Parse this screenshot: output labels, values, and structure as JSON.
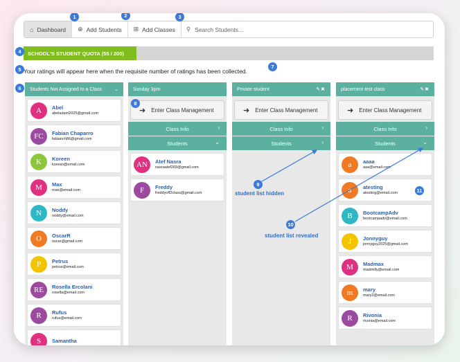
{
  "nav": {
    "dashboard": "Dashboard",
    "add_students": "Add Students",
    "add_classes": "Add Classes",
    "search_placeholder": "Search Students..."
  },
  "quota": {
    "label": "SCHOOL'S STUDENT QUOTA (55 / 200)",
    "used": 55,
    "total": 200
  },
  "ratings_message": "Your ratings will appear here when the requisite number of ratings has been collected.",
  "unassigned": {
    "title": "Students Not Assigned to a Class",
    "students": [
      {
        "initials": "A",
        "name": "Abel",
        "email": "abeladam2025@gmail.com",
        "color": "#e0307f"
      },
      {
        "initials": "FC",
        "name": "Fabian Chaparro",
        "email": "fabianch86@gmail.com",
        "color": "#9b4aa0"
      },
      {
        "initials": "K",
        "name": "Koreen",
        "email": "korean@email.com",
        "color": "#8cc63f"
      },
      {
        "initials": "M",
        "name": "Max",
        "email": "max@email.com",
        "color": "#e0307f"
      },
      {
        "initials": "N",
        "name": "Noddy",
        "email": "noddy@email.com",
        "color": "#2cb8c4"
      },
      {
        "initials": "O",
        "name": "OscarR",
        "email": "oscar@gmail.com",
        "color": "#f07a23"
      },
      {
        "initials": "P",
        "name": "Petrus",
        "email": "petrus@email.com",
        "color": "#f5c400"
      },
      {
        "initials": "RE",
        "name": "Rosella Ercolani",
        "email": "rosella@email.com",
        "color": "#9b4aa0"
      },
      {
        "initials": "R",
        "name": "Rufus",
        "email": "rufus@email.com",
        "color": "#9b4aa0"
      },
      {
        "initials": "S",
        "name": "Samantha",
        "email": "",
        "color": "#e0307f"
      }
    ]
  },
  "classes": [
    {
      "title": "Sunday 3pm",
      "enter_label": "Enter Class Management",
      "info_label": "Class Info",
      "students_label": "Students",
      "students": [
        {
          "initials": "AN",
          "name": "Atef Nasra",
          "email": "nasraatef269@gmail.com",
          "color": "#e0307f"
        },
        {
          "initials": "F",
          "name": "Freddy",
          "email": "freddyoff2class@gmail.com",
          "color": "#9b4aa0"
        }
      ]
    },
    {
      "title": "Private student",
      "enter_label": "Enter Class Management",
      "info_label": "Class Info",
      "students_label": "Students",
      "students": []
    },
    {
      "title": "placement test class",
      "enter_label": "Enter Class Management",
      "info_label": "Class Info",
      "students_label": "Students",
      "students": [
        {
          "initials": "a",
          "name": "aaaa",
          "email": "aaa@email.com",
          "color": "#f07a23"
        },
        {
          "initials": "a",
          "name": "atesting",
          "email": "atesting@email.com",
          "color": "#f07a23"
        },
        {
          "initials": "B",
          "name": "BootcampAdv",
          "email": "bootcampadv@email.com",
          "color": "#2cb8c4"
        },
        {
          "initials": "J",
          "name": "Jonnyguy",
          "email": "jonnyguy2025@gmail.com",
          "color": "#f5c400"
        },
        {
          "initials": "M",
          "name": "Madmax",
          "email": "madmilly@email.com",
          "color": "#e0307f"
        },
        {
          "initials": "m",
          "name": "mary",
          "email": "mary2@email.com",
          "color": "#f07a23"
        },
        {
          "initials": "R",
          "name": "Rivonia",
          "email": "rivonia@email.com",
          "color": "#9b4aa0"
        }
      ]
    }
  ],
  "annotations": {
    "badges": [
      "1",
      "2",
      "3",
      "4",
      "5",
      "6",
      "7",
      "8",
      "9",
      "10",
      "11"
    ],
    "hidden_label": "student list hidden",
    "revealed_label": "student list revealed"
  },
  "colors": {
    "teal": "#5bb0a0",
    "quota_green": "#7fbc20",
    "annotation_blue": "#3b7ad9"
  }
}
